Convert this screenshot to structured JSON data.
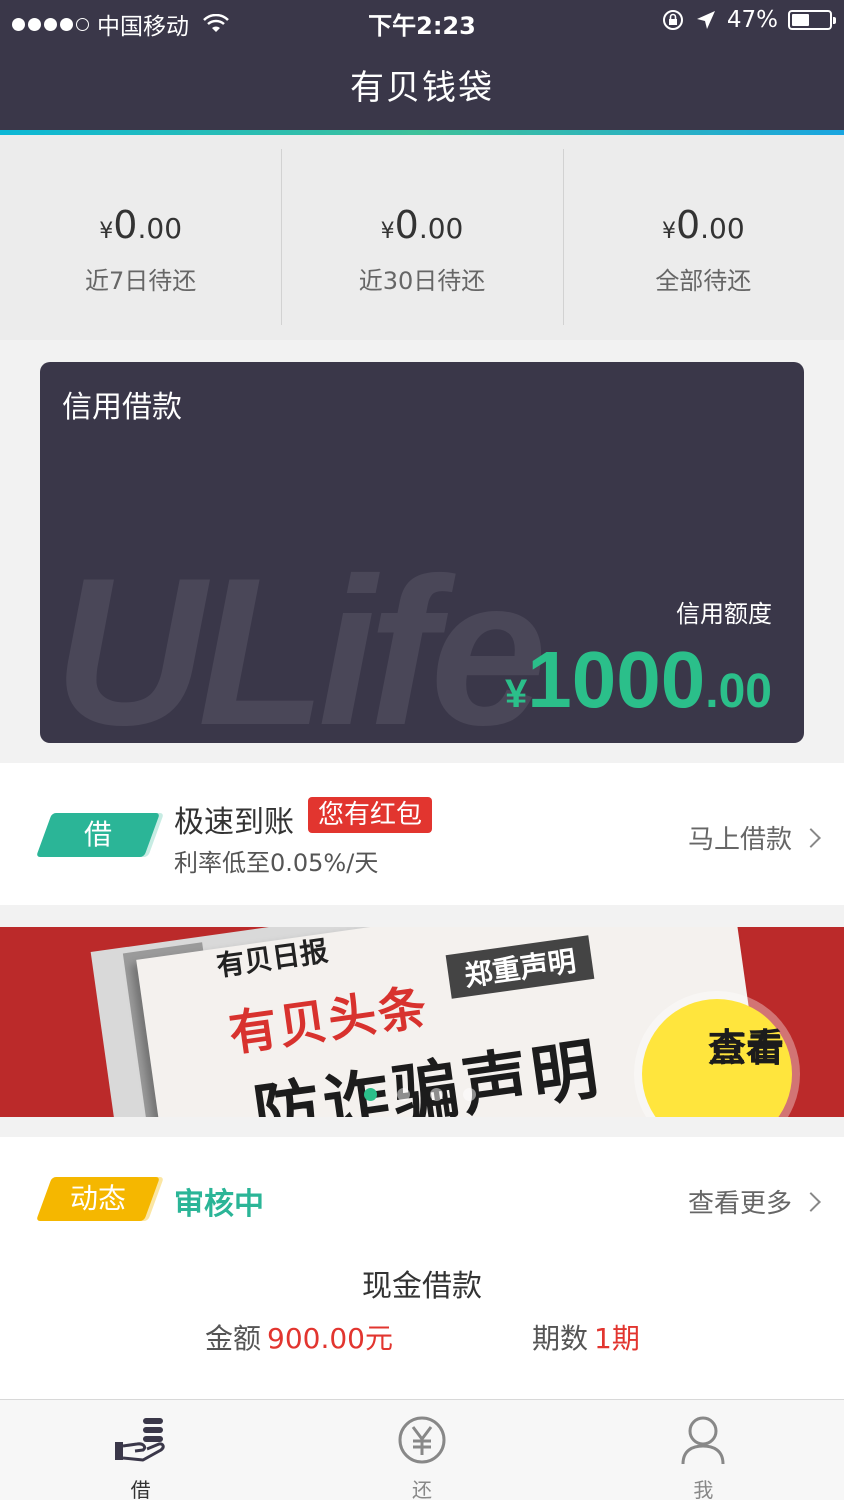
{
  "status_bar": {
    "carrier": "中国移动",
    "time": "下午2:23",
    "battery": "47%",
    "battery_level": 0.47
  },
  "navbar": {
    "title": "有贝钱袋"
  },
  "summary": [
    {
      "currency": "¥",
      "int": "0",
      "dec": ".00",
      "label": "近7日待还"
    },
    {
      "currency": "¥",
      "int": "0",
      "dec": ".00",
      "label": "近30日待还"
    },
    {
      "currency": "¥",
      "int": "0",
      "dec": ".00",
      "label": "全部待还"
    }
  ],
  "credit_card": {
    "title": "信用借款",
    "watermark": "ULife",
    "limit_label": "信用额度",
    "currency": "¥",
    "limit_int": "1000",
    "limit_dec": ".00"
  },
  "loan_entry": {
    "tag": "借",
    "title": "极速到账",
    "badge": "您有红包",
    "subtitle": "利率低至0.05%/天",
    "action": "马上借款"
  },
  "banner": {
    "daily": "有贝日报",
    "declaration": "郑重声明",
    "headline": "有贝头条",
    "main": "防诈骗声明",
    "button_line1": "点击",
    "button_line2": "查看",
    "slide_count": 4,
    "active_slide": 1
  },
  "activity": {
    "tag": "动态",
    "status": "审核中",
    "more": "查看更多",
    "product": "现金借款",
    "amount_label": "金额",
    "amount_value": "900.00元",
    "periods_label": "期数",
    "periods_value": "1期"
  },
  "tabbar": [
    {
      "label": "借",
      "icon": "borrow-hand-coins-icon",
      "active": true
    },
    {
      "label": "还",
      "icon": "yen-circle-icon",
      "active": false
    },
    {
      "label": "我",
      "icon": "person-icon",
      "active": false
    }
  ],
  "colors": {
    "header": "#3a3749",
    "accent_green": "#2bbf8a",
    "red": "#e2352f",
    "yellow_tag": "#f5b700"
  }
}
